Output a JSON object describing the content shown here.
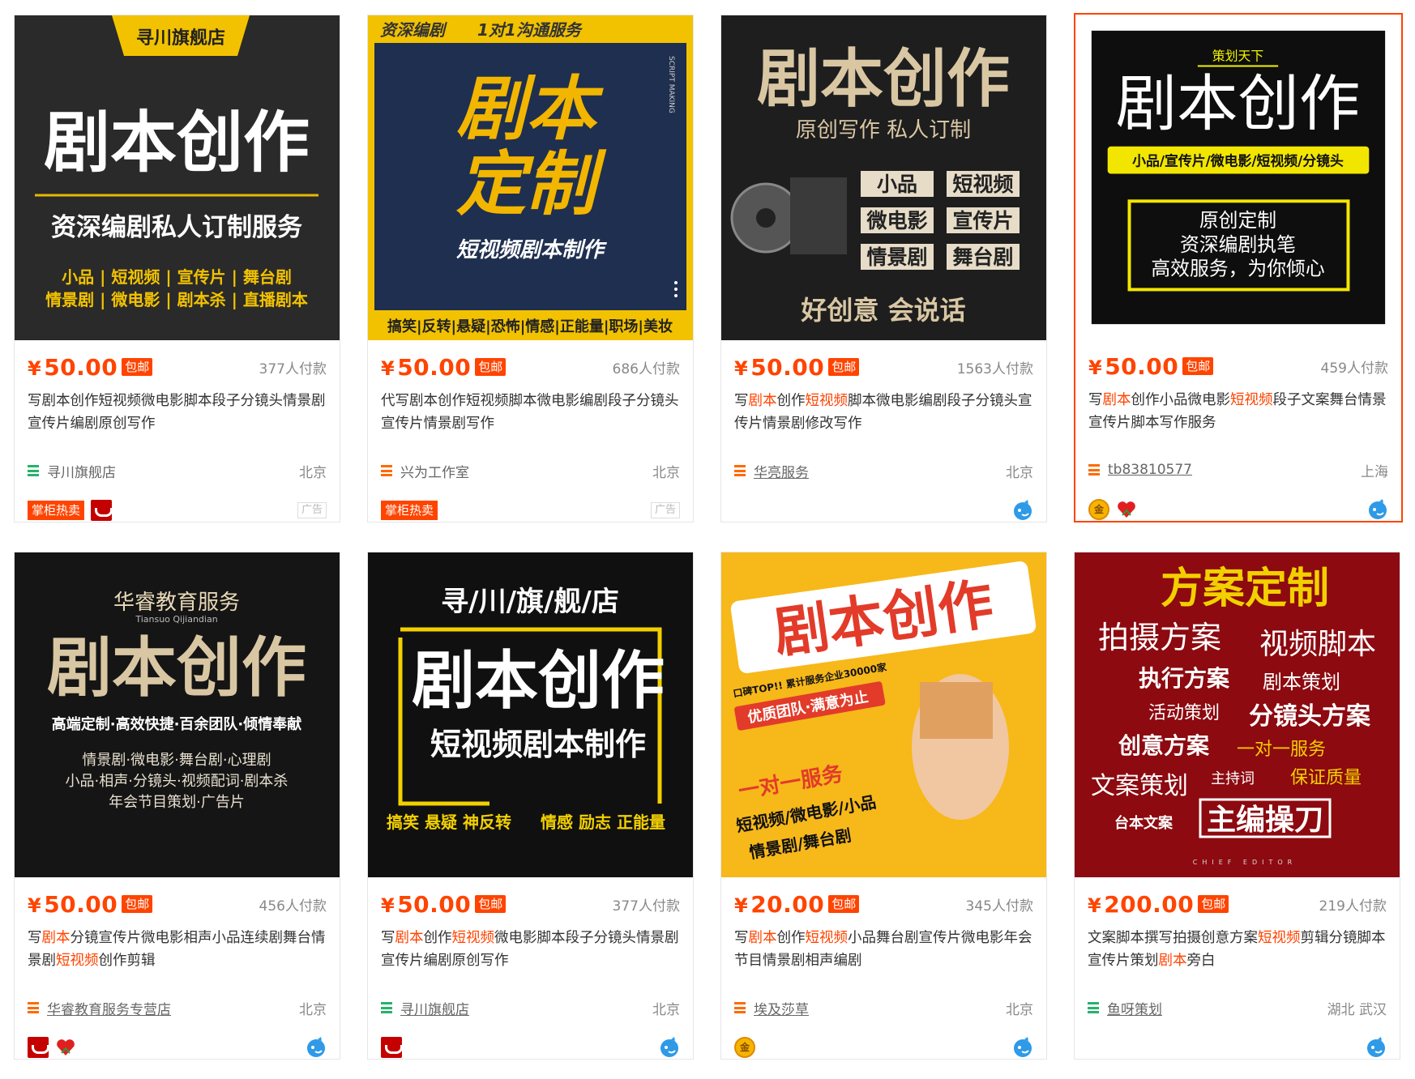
{
  "currency_symbol": "¥",
  "products": [
    {
      "price": "50.00",
      "free_ship": "包邮",
      "sales": "377人付款",
      "title_parts": [
        {
          "t": "写剧本创作短视频微电影脚本段子分镜头情景剧宣传片编剧原创写作",
          "hl": false
        }
      ],
      "shop": "寻川旗舰店",
      "shop_icon": "green",
      "shop_link": false,
      "location": "北京",
      "hot_tag": "掌柜热卖",
      "badges": [
        "tmall-icon"
      ],
      "ad_tag": "广告",
      "wangwang": false,
      "image": {
        "banner": "寻川旗舰店",
        "headline": "剧本创作",
        "subline": "资深编剧私人订制服务",
        "line1": "小品 | 短视频 | 宣传片 | 舞台剧",
        "line2": "情景剧 | 微电影 | 剧本杀 | 直播剧本"
      }
    },
    {
      "price": "50.00",
      "free_ship": "包邮",
      "sales": "686人付款",
      "title_parts": [
        {
          "t": "代写剧本创作短视频脚本微电影编剧段子分镜头宣传片情景剧写作",
          "hl": false
        }
      ],
      "shop": "兴为工作室",
      "shop_icon": "orange",
      "shop_link": false,
      "location": "北京",
      "hot_tag": "掌柜热卖",
      "badges": [],
      "ad_tag": "广告",
      "wangwang": false,
      "image": {
        "top_left": "资深编剧",
        "top_right": "1对1沟通服务",
        "side": "SCRIPT MAKING",
        "headline1": "剧本",
        "headline2": "定制",
        "subline": "短视频剧本制作",
        "bottom": "搞笑|反转|悬疑|恐怖|情感|正能量|职场|美妆"
      }
    },
    {
      "price": "50.00",
      "free_ship": "包邮",
      "sales": "1563人付款",
      "title_parts": [
        {
          "t": "写",
          "hl": false
        },
        {
          "t": "剧本",
          "hl": true
        },
        {
          "t": "创作",
          "hl": false
        },
        {
          "t": "短视频",
          "hl": true
        },
        {
          "t": "脚本微电影编剧段子分镜头宣传片情景剧修改写作",
          "hl": false
        }
      ],
      "shop": "华亮服务",
      "shop_icon": "orange",
      "shop_link": true,
      "location": "北京",
      "hot_tag": "",
      "badges": [],
      "ad_tag": "",
      "wangwang": true,
      "image": {
        "headline": "剧本创作",
        "subline": "原创写作  私人订制",
        "tags": [
          "小品",
          "短视频",
          "微电影",
          "宣传片",
          "情景剧",
          "舞台剧"
        ],
        "slogan": "好创意   会说话"
      }
    },
    {
      "price": "50.00",
      "free_ship": "包邮",
      "sales": "459人付款",
      "title_parts": [
        {
          "t": "写",
          "hl": false
        },
        {
          "t": "剧本",
          "hl": true
        },
        {
          "t": "创作小品微电影",
          "hl": false
        },
        {
          "t": "短视频",
          "hl": true
        },
        {
          "t": "段子文案舞台情景宣传片脚本写作服务",
          "hl": false
        }
      ],
      "shop": "tb83810577",
      "shop_icon": "orange",
      "shop_link": true,
      "location": "上海",
      "hot_tag": "",
      "badges": [
        "gold-icon",
        "heart-icon"
      ],
      "ad_tag": "",
      "wangwang": true,
      "image": {
        "top": "策划天下",
        "headline": "剧本创作",
        "subline": "小品/宣传片/微电影/短视频/分镜头",
        "box1": "原创定制",
        "box2": "资深编剧执笔",
        "box3": "高效服务，为你倾心"
      }
    },
    {
      "price": "50.00",
      "free_ship": "包邮",
      "sales": "456人付款",
      "title_parts": [
        {
          "t": "写",
          "hl": false
        },
        {
          "t": "剧本",
          "hl": true
        },
        {
          "t": "分镜宣传片微电影相声小品连续剧舞台情景剧",
          "hl": false
        },
        {
          "t": "短视频",
          "hl": true
        },
        {
          "t": "创作剪辑",
          "hl": false
        }
      ],
      "shop": "华睿教育服务专营店",
      "shop_icon": "orange",
      "shop_link": true,
      "location": "北京",
      "hot_tag": "",
      "badges": [
        "tmall-icon",
        "heart-icon"
      ],
      "ad_tag": "",
      "wangwang": true,
      "image": {
        "brand": "华睿教育服务",
        "brand_en": "Tiansuo Qijiandian",
        "headline": "剧本创作",
        "subline": "高端定制·高效快捷·百余团队·倾情奉献",
        "line1": "情景剧·微电影·舞台剧·心理剧",
        "line2": "小品·相声·分镜头·视频配词·剧本杀",
        "line3": "年会节目策划·广告片"
      }
    },
    {
      "price": "50.00",
      "free_ship": "包邮",
      "sales": "377人付款",
      "title_parts": [
        {
          "t": "写",
          "hl": false
        },
        {
          "t": "剧本",
          "hl": true
        },
        {
          "t": "创作",
          "hl": false
        },
        {
          "t": "短视频",
          "hl": true
        },
        {
          "t": "微电影脚本段子分镜头情景剧宣传片编剧原创写作",
          "hl": false
        }
      ],
      "shop": "寻川旗舰店",
      "shop_icon": "green",
      "shop_link": true,
      "location": "北京",
      "hot_tag": "",
      "badges": [
        "tmall-icon"
      ],
      "ad_tag": "",
      "wangwang": true,
      "image": {
        "top": "寻/川/旗/舰/店",
        "headline": "剧本创作",
        "subline": "短视频剧本制作",
        "bottom_left": "搞笑 悬疑 神反转",
        "bottom_right": "情感 励志 正能量"
      }
    },
    {
      "price": "20.00",
      "free_ship": "包邮",
      "sales": "345人付款",
      "title_parts": [
        {
          "t": "写",
          "hl": false
        },
        {
          "t": "剧本",
          "hl": true
        },
        {
          "t": "创作",
          "hl": false
        },
        {
          "t": "短视频",
          "hl": true
        },
        {
          "t": "小品舞台剧宣传片微电影年会节目情景剧相声编剧",
          "hl": false
        }
      ],
      "shop": "埃及莎草",
      "shop_icon": "orange",
      "shop_link": true,
      "location": "北京",
      "hot_tag": "",
      "badges": [
        "gold-icon"
      ],
      "ad_tag": "",
      "wangwang": true,
      "image": {
        "headline": "剧本创作",
        "line1": "口碑TOP!! 累计服务企业30000家",
        "line2": "优质团队·满意为止",
        "line3": "一对一服务",
        "line4": "短视频/微电影/小品",
        "line5": "情景剧/舞台剧"
      }
    },
    {
      "price": "200.00",
      "free_ship": "包邮",
      "sales": "219人付款",
      "title_parts": [
        {
          "t": "文案脚本撰写拍摄创意方案",
          "hl": false
        },
        {
          "t": "短视频",
          "hl": true
        },
        {
          "t": "剪辑分镜脚本宣传片策划",
          "hl": false
        },
        {
          "t": "剧本",
          "hl": true
        },
        {
          "t": "旁白",
          "hl": false
        }
      ],
      "shop": "鱼呀策划",
      "shop_icon": "green",
      "shop_link": true,
      "location": "湖北 武汉",
      "hot_tag": "",
      "badges": [],
      "ad_tag": "",
      "wangwang": true,
      "image": {
        "headline": "方案定制",
        "w1": "拍摄方案",
        "w2": "视频脚本",
        "w3": "执行方案",
        "w4": "剧本策划",
        "w5": "活动策划",
        "w6": "分镜头方案",
        "w7": "创意方案",
        "w8": "一对一服务",
        "w9": "主持词",
        "w10": "保证质量",
        "w11": "文案策划",
        "w12": "台本文案",
        "w13": "主编操刀",
        "w14": "CHIEF EDITOR"
      }
    }
  ]
}
